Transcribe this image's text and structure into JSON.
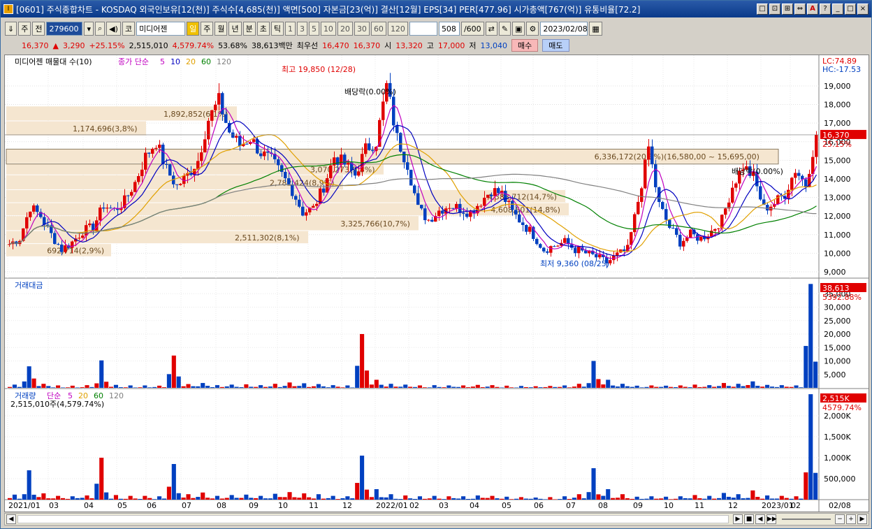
{
  "title": "[0601] 주식종합차트 - KOSDAQ 외국인보유[12(천)] 주식수[4,685(천)] 액면[500] 자본금[23(억)] 결산[12월] EPS[34] PER[477.96] 시가총액[767(억)] 유통비율[72.2]",
  "window_buttons": [
    "□",
    "⊡",
    "⊞",
    "⇔",
    "A",
    "?",
    "_",
    "□",
    "×"
  ],
  "toolbar": {
    "period": "주",
    "prev": "전",
    "code": "279600",
    "stock_name": "미디어젠",
    "market": "코",
    "periods": [
      "일",
      "주",
      "월",
      "년",
      "분",
      "초",
      "틱"
    ],
    "selected_period": "일",
    "intervals": [
      "1",
      "3",
      "5",
      "10",
      "20",
      "30",
      "60",
      "120"
    ],
    "count": "508",
    "count_total": "/600",
    "date": "2023/02/08"
  },
  "price": {
    "current": "16,370",
    "change": "3,290",
    "rate": "+25.15%",
    "volume": "2,515,010",
    "vol_rate": "4,579.74%",
    "vol_pct": "53.68%",
    "amount": "38,613백만",
    "best_label": "최우선",
    "ask": "16,470",
    "bid": "16,370",
    "open_label": "시",
    "open": "13,320",
    "high_label": "고",
    "high": "17,000",
    "low_label": "저",
    "low": "13,040",
    "buy": "매수",
    "sell": "매도"
  },
  "panels": {
    "price_title": "미디어젠 매물대 수(10)",
    "ma_label": "종가 단순",
    "ma_list": [
      "5",
      "10",
      "20",
      "60",
      "120"
    ],
    "lc": "LC:74.89",
    "hc": "HC:-17.53",
    "high_marker": "최고 19,850 (12/28)",
    "low_marker": "최저 9,360 (08/25)",
    "dividend1": "배당락(0.00%)",
    "dividend2": "배당락(0.00%)",
    "price_box": "16,370",
    "price_box_rate": "25.15%",
    "amount_title": "거래대금",
    "amount_box": "38,613",
    "amount_box_rate": "5392.88%",
    "volume_title": "거래량",
    "volume_ma_label": "단순",
    "volume_ma_list": [
      "5",
      "20",
      "60",
      "120"
    ],
    "volume_info": "2,515,010주(4,579.74%)",
    "volume_box": "2,515K",
    "volume_box_rate": "4579.74%"
  },
  "volume_profile": [
    {
      "label": "692,714(2,9%)"
    },
    {
      "label": "2,511,302(8,1%)"
    },
    {
      "label": "3,325,766(10,7%)"
    },
    {
      "label": "4,608,501(14,8%)"
    },
    {
      "label": "4,588,712(14,7%)"
    },
    {
      "label": "2,782,424(8,9%)"
    },
    {
      "label": "6,336,172(20,3%)(16,580,00 ~ 15,695,00)"
    },
    {
      "label": "1,174,696(3,8%)"
    },
    {
      "label": "1,892,852(6,1%)"
    },
    {
      "label": "3,070,273(9,8%)"
    }
  ],
  "y_price_ticks": [
    "19,000",
    "18,000",
    "17,000",
    "16,000",
    "15,000",
    "14,000",
    "13,000",
    "12,000",
    "11,000",
    "10,000",
    "9,000"
  ],
  "y_amount_ticks": [
    "35,000",
    "30,000",
    "25,000",
    "20,000",
    "15,000",
    "10,000",
    "5,000"
  ],
  "y_volume_ticks": [
    "2,000K",
    "1,500K",
    "1,000K",
    "500,000"
  ],
  "x_ticks": [
    "2021/01",
    "03",
    "04",
    "05",
    "06",
    "07",
    "08",
    "09",
    "10",
    "11",
    "12",
    "2022/01",
    "02",
    "03",
    "04",
    "05",
    "06",
    "07",
    "08",
    "09",
    "10",
    "11",
    "12",
    "2023/01",
    "02",
    "02/08"
  ],
  "colors": {
    "up": "#e00000",
    "down": "#0040c0",
    "ma5": "#c000c0",
    "ma10": "#0000c0",
    "ma20": "#e0a000",
    "ma60": "#008000",
    "ma120": "#808080",
    "profile": "#f5e6d0"
  },
  "chart_data": {
    "type": "candlestick",
    "price_series": [
      10500,
      10800,
      12500,
      12000,
      11000,
      10200,
      10600,
      11200,
      11400,
      12600,
      12300,
      12800,
      13800,
      15200,
      16000,
      14500,
      13600,
      14200,
      15000,
      17200,
      18200,
      16500,
      15800,
      16200,
      15400,
      15000,
      14200,
      13400,
      12200,
      12400,
      13600,
      15200,
      14800,
      14200,
      15600,
      16000,
      19000,
      16200,
      14800,
      12400,
      11800,
      12300,
      12600,
      12400,
      12200,
      12800,
      13400,
      13200,
      12200,
      11600,
      11000,
      10200,
      10400,
      10600,
      10200,
      10000,
      9800,
      9500,
      9900,
      10200,
      12800,
      15700,
      12600,
      11400,
      10600,
      11000,
      10800,
      11200,
      11800,
      13600,
      14700,
      14100,
      12400,
      12700,
      13200,
      14500,
      13700,
      16370
    ],
    "amount_series": [
      1200,
      8000,
      1500,
      900,
      800,
      1000,
      10200,
      1100,
      900,
      900,
      800,
      12000,
      1400,
      1800,
      1000,
      1200,
      1300,
      1000,
      1500,
      2000,
      1700,
      1400,
      1000,
      900,
      20000,
      3000,
      1500,
      1200,
      900,
      1000,
      900,
      900,
      1100,
      1000,
      800,
      700,
      600,
      700,
      900,
      1500,
      10000,
      3000,
      1500,
      800,
      900,
      800,
      900,
      1200,
      1000,
      1800,
      1500,
      2400,
      1100,
      1000,
      900,
      38613
    ],
    "volume_series": [
      120,
      700,
      150,
      90,
      80,
      100,
      1000,
      110,
      90,
      90,
      80,
      850,
      130,
      170,
      90,
      110,
      120,
      90,
      140,
      180,
      150,
      130,
      90,
      80,
      1050,
      250,
      130,
      100,
      80,
      90,
      80,
      80,
      100,
      90,
      70,
      60,
      50,
      60,
      80,
      130,
      750,
      250,
      130,
      70,
      80,
      70,
      80,
      110,
      90,
      160,
      130,
      220,
      100,
      90,
      80,
      2515
    ]
  }
}
